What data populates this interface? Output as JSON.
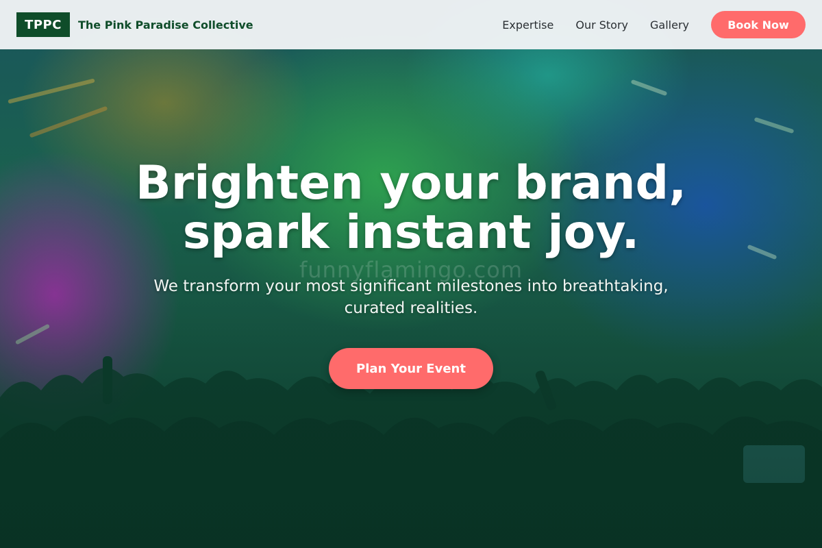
{
  "brand": {
    "logo_text": "TPPC",
    "name": "The Pink Paradise Collective"
  },
  "nav": {
    "links": [
      "Expertise",
      "Our Story",
      "Gallery"
    ],
    "book_label": "Book Now"
  },
  "hero": {
    "headline_line1": "Brighten your brand,",
    "headline_line2": "spark instant joy.",
    "subheadline": "We transform your most significant milestones into breathtaking, curated realities.",
    "cta_label": "Plan Your Event",
    "watermark_text": "funnyflamingo.com"
  },
  "colors": {
    "brand_green": "#0f4d2a",
    "accent_coral": "#ff6b6b",
    "nav_background": "#f0f4f6"
  }
}
